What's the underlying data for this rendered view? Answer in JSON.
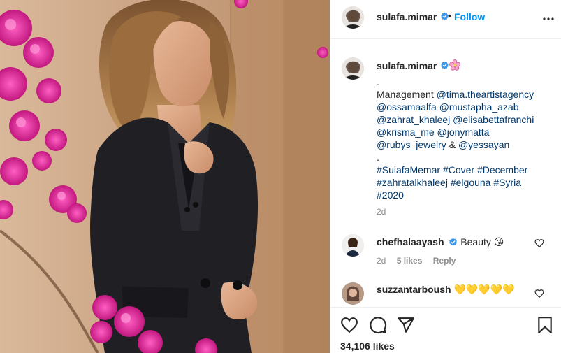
{
  "post": {
    "author": "sulafa.mimar",
    "follow_label": "Follow",
    "caption": {
      "emoji": "cherry-blossom",
      "lines": [
        ".",
        "Management @tima.theartistagency",
        "@ossamaalfa @mustapha_azab",
        "@zahrat_khaleej @elisabettafranchi",
        "@krisma_me @jonymatta",
        "@rubys_jewelry & @yessayan",
        ".",
        "#SulafaMemar #Cover #December",
        "#zahratalkhaleej #elgouna #Syria",
        "#2020"
      ],
      "time": "2d"
    },
    "comments": [
      {
        "user": "chefhalaayash",
        "verified": true,
        "text": "Beauty 😘",
        "time": "2d",
        "likes": "5 likes",
        "reply": "Reply"
      },
      {
        "user": "suzzantarboush",
        "verified": false,
        "text": "💛💛💛💛💛",
        "time": "",
        "likes": "",
        "reply": ""
      }
    ],
    "likes": "34,106 likes"
  },
  "colors": {
    "link": "#00376b",
    "follow": "#0095f6",
    "verified": "#3897f0",
    "muted": "#8e8e8e"
  },
  "icons": [
    "verified-badge-icon",
    "more-options-icon",
    "heart-icon",
    "comment-icon",
    "share-icon",
    "bookmark-icon"
  ]
}
